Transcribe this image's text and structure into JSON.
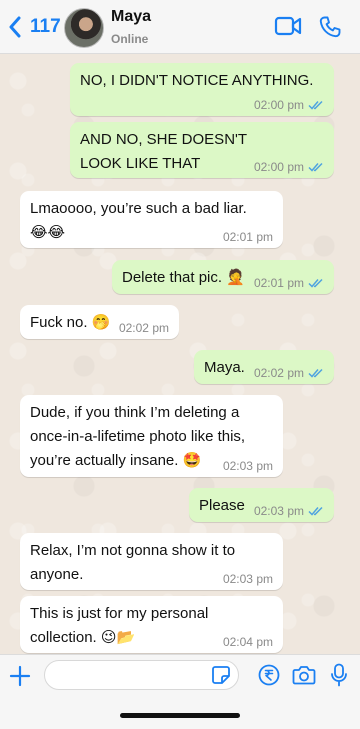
{
  "header": {
    "back_count": "117",
    "contact_name": "Maya",
    "contact_status": "Online"
  },
  "messages": [
    {
      "direction": "out",
      "text": "NO, I DIDN'T NOTICE ANYTHING.",
      "time": "02:00 pm",
      "read": true
    },
    {
      "direction": "out",
      "text": "AND NO, SHE DOESN'T LOOK LIKE THAT",
      "time": "02:00 pm",
      "read": true
    },
    {
      "direction": "in",
      "text": "Lmaoooo, you’re such a bad liar. 😂😂",
      "time": "02:01 pm"
    },
    {
      "direction": "out",
      "text": "Delete that pic. 🤦",
      "time": "02:01 pm",
      "read": true
    },
    {
      "direction": "in",
      "text": "Fuck no. 🤭",
      "time": "02:02 pm"
    },
    {
      "direction": "out",
      "text": "Maya.",
      "time": "02:02 pm",
      "read": true
    },
    {
      "direction": "in",
      "text": "Dude, if you think I’m deleting a once-in-a-lifetime photo like this, you’re actually insane. 🤩",
      "time": "02:03 pm"
    },
    {
      "direction": "out",
      "text": "Please",
      "time": "02:03 pm",
      "read": true
    },
    {
      "direction": "in",
      "text": "Relax, I’m not gonna show it to anyone.",
      "time": "02:03 pm"
    },
    {
      "direction": "in",
      "text": "This is just for my personal collection. 😉📂",
      "time": "02:04 pm"
    }
  ],
  "composer": {
    "placeholder": ""
  },
  "colors": {
    "accent": "#1a7ff2",
    "outgoing_bubble": "#dcf8c6",
    "incoming_bubble": "#ffffff",
    "chat_background": "#efe7de",
    "read_ticks": "#4fa3e0"
  },
  "icons": {
    "header": [
      "chevron-left-icon",
      "video-call-icon",
      "phone-icon"
    ],
    "composer": [
      "plus-icon",
      "sticker-icon",
      "rupee-payment-icon",
      "camera-icon",
      "microphone-icon"
    ]
  }
}
